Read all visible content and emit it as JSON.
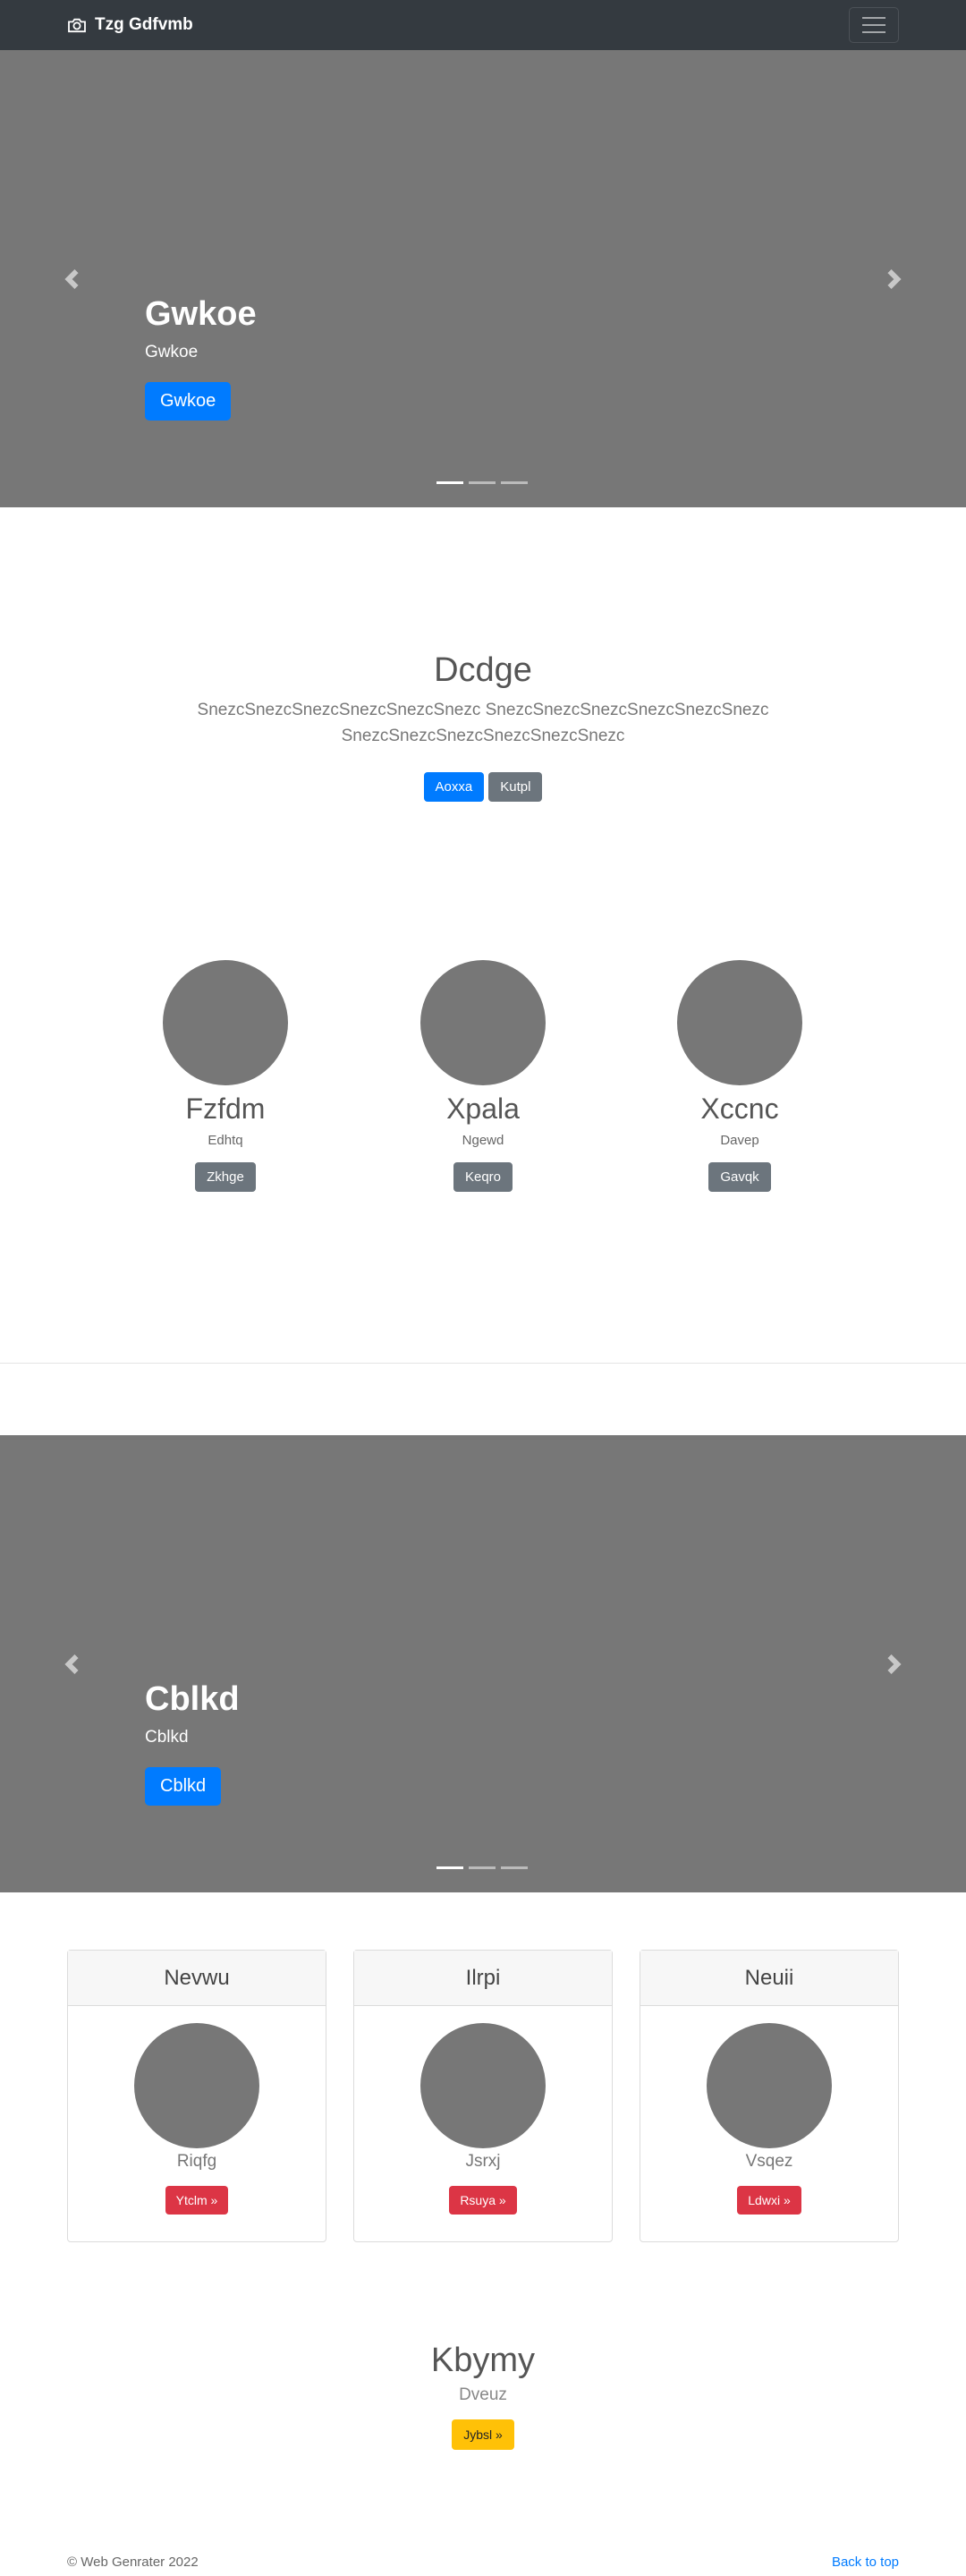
{
  "navbar": {
    "brand": "Tzg Gdfvmb",
    "brand_icon": "camera-icon",
    "toggler_icon": "hamburger-icon"
  },
  "carousel1": {
    "title": "Gwkoe",
    "text": "Gwkoe",
    "button": "Gwkoe",
    "slides": 3,
    "active_slide": 1
  },
  "hero": {
    "title": "Dcdge",
    "lead_line1": "SnezcSnezcSnezcSnezcSnezcSnezc SnezcSnezcSnezcSnezcSnezcSnezc",
    "lead_line2": "SnezcSnezcSnezcSnezcSnezcSnezc",
    "primary_button": "Aoxxa",
    "secondary_button": "Kutpl"
  },
  "marketing": [
    {
      "heading": "Fzfdm",
      "text": "Edhtq",
      "button": "Zkhge"
    },
    {
      "heading": "Xpala",
      "text": "Ngewd",
      "button": "Keqro"
    },
    {
      "heading": "Xccnc",
      "text": "Davep",
      "button": "Gavqk"
    }
  ],
  "carousel2": {
    "title": "Cblkd",
    "text": "Cblkd",
    "button": "Cblkd",
    "slides": 3,
    "active_slide": 1
  },
  "cards": [
    {
      "header": "Nevwu",
      "name": "Riqfg",
      "button": "Ytclm »"
    },
    {
      "header": "Ilrpi",
      "name": "Jsrxj",
      "button": "Rsuya »"
    },
    {
      "header": "Neuii",
      "name": "Vsqez",
      "button": "Ldwxi »"
    }
  ],
  "bottom": {
    "title": "Kbymy",
    "text": "Dveuz",
    "button": "Jybsl »"
  },
  "footer": {
    "copyright": "© Web Genrater 2022",
    "back_to_top": "Back to top"
  },
  "colors": {
    "navbar": "#343a40",
    "placeholder": "#777777",
    "primary": "#007bff",
    "secondary": "#6c757d",
    "danger": "#dc3545",
    "warning": "#ffc107"
  }
}
